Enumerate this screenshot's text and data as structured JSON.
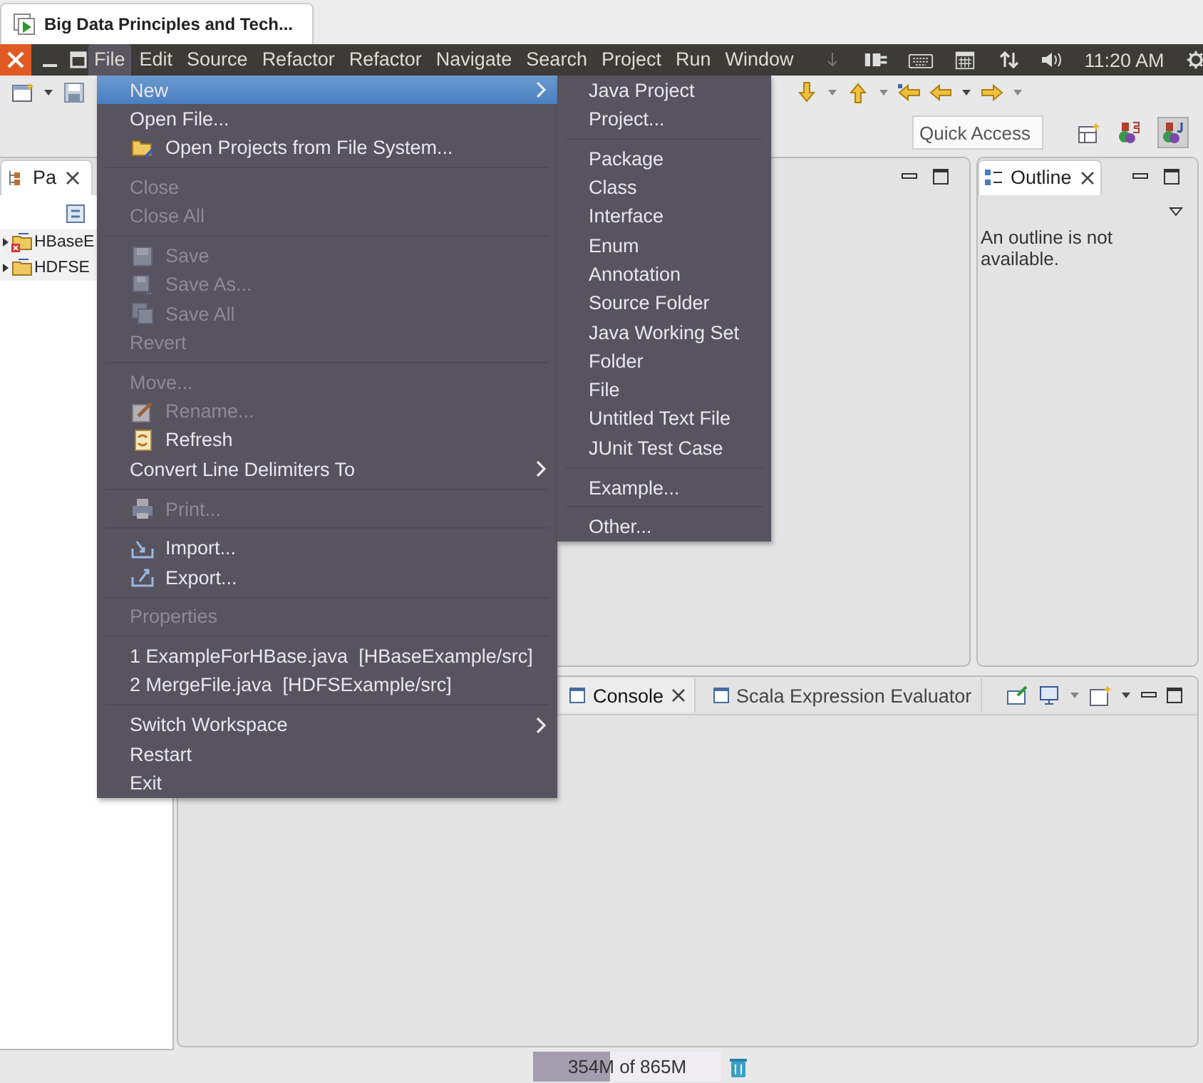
{
  "window": {
    "title": "Big Data Principles and Tech..."
  },
  "menubar": [
    {
      "label": "File",
      "selected": true
    },
    {
      "label": "Edit",
      "selected": false
    },
    {
      "label": "Source",
      "selected": false
    },
    {
      "label": "Refactor",
      "selected": false
    },
    {
      "label": "Refactor",
      "selected": false
    },
    {
      "label": "Navigate",
      "selected": false
    },
    {
      "label": "Search",
      "selected": false
    },
    {
      "label": "Project",
      "selected": false
    },
    {
      "label": "Run",
      "selected": false
    },
    {
      "label": "Window",
      "selected": false
    }
  ],
  "tray": {
    "time": "11:20 AM"
  },
  "quick_access": {
    "placeholder": "Quick Access"
  },
  "package_explorer": {
    "tab": "Pa",
    "items": [
      {
        "label": "HBaseE",
        "error": true
      },
      {
        "label": "HDFSE",
        "error": false
      }
    ]
  },
  "outline": {
    "tab": "Outline",
    "message": "An outline is not available."
  },
  "bottom_tabs": [
    {
      "label": "Console",
      "selected": true
    },
    {
      "label": "Scala Expression Evaluator",
      "selected": false
    }
  ],
  "status_bar": {
    "memory": "354M of 865M",
    "level": 0.41
  },
  "file_menu": [
    {
      "kind": "item",
      "label": "New",
      "disabled": false,
      "selected": true,
      "submenu": true
    },
    {
      "kind": "item",
      "label": "Open File...",
      "disabled": false,
      "selected": false,
      "submenu": false
    },
    {
      "kind": "item",
      "label": "Open Projects from File System...",
      "disabled": false,
      "selected": false,
      "submenu": false
    },
    {
      "kind": "separator"
    },
    {
      "kind": "item",
      "label": "Close",
      "disabled": true,
      "selected": false,
      "submenu": false
    },
    {
      "kind": "item",
      "label": "Close All",
      "disabled": true,
      "selected": false,
      "submenu": false
    },
    {
      "kind": "separator"
    },
    {
      "kind": "item",
      "label": "Save",
      "disabled": true,
      "selected": false,
      "submenu": false
    },
    {
      "kind": "item",
      "label": "Save As...",
      "disabled": true,
      "selected": false,
      "submenu": false
    },
    {
      "kind": "item",
      "label": "Save All",
      "disabled": true,
      "selected": false,
      "submenu": false
    },
    {
      "kind": "item",
      "label": "Revert",
      "disabled": true,
      "selected": false,
      "submenu": false
    },
    {
      "kind": "separator"
    },
    {
      "kind": "item",
      "label": "Move...",
      "disabled": true,
      "selected": false,
      "submenu": false
    },
    {
      "kind": "item",
      "label": "Rename...",
      "disabled": true,
      "selected": false,
      "submenu": false
    },
    {
      "kind": "item",
      "label": "Refresh",
      "disabled": false,
      "selected": false,
      "submenu": false
    },
    {
      "kind": "item",
      "label": "Convert Line Delimiters To",
      "disabled": false,
      "selected": false,
      "submenu": true
    },
    {
      "kind": "separator"
    },
    {
      "kind": "item",
      "label": "Print...",
      "disabled": true,
      "selected": false,
      "submenu": false
    },
    {
      "kind": "separator"
    },
    {
      "kind": "item",
      "label": "Import...",
      "disabled": false,
      "selected": false,
      "submenu": false
    },
    {
      "kind": "item",
      "label": "Export...",
      "disabled": false,
      "selected": false,
      "submenu": false
    },
    {
      "kind": "separator"
    },
    {
      "kind": "item",
      "label": "Properties",
      "disabled": true,
      "selected": false,
      "submenu": false
    },
    {
      "kind": "separator"
    },
    {
      "kind": "item",
      "label": "1 ExampleForHBase.java  [HBaseExample/src]",
      "disabled": false,
      "selected": false,
      "submenu": false
    },
    {
      "kind": "item",
      "label": "2 MergeFile.java  [HDFSExample/src]",
      "disabled": false,
      "selected": false,
      "submenu": false
    },
    {
      "kind": "separator"
    },
    {
      "kind": "item",
      "label": "Switch Workspace",
      "disabled": false,
      "selected": false,
      "submenu": true
    },
    {
      "kind": "item",
      "label": "Restart",
      "disabled": false,
      "selected": false,
      "submenu": false
    },
    {
      "kind": "item",
      "label": "Exit",
      "disabled": false,
      "selected": false,
      "submenu": false
    }
  ],
  "new_submenu": [
    {
      "kind": "item",
      "label": "Java Project"
    },
    {
      "kind": "item",
      "label": "Project..."
    },
    {
      "kind": "separator"
    },
    {
      "kind": "item",
      "label": "Package"
    },
    {
      "kind": "item",
      "label": "Class"
    },
    {
      "kind": "item",
      "label": "Interface"
    },
    {
      "kind": "item",
      "label": "Enum"
    },
    {
      "kind": "item",
      "label": "Annotation"
    },
    {
      "kind": "item",
      "label": "Source Folder"
    },
    {
      "kind": "item",
      "label": "Java Working Set"
    },
    {
      "kind": "item",
      "label": "Folder"
    },
    {
      "kind": "item",
      "label": "File"
    },
    {
      "kind": "item",
      "label": "Untitled Text File"
    },
    {
      "kind": "item",
      "label": "JUnit Test Case"
    },
    {
      "kind": "separator"
    },
    {
      "kind": "item",
      "label": "Example..."
    },
    {
      "kind": "separator"
    },
    {
      "kind": "item",
      "label": "Other..."
    }
  ]
}
